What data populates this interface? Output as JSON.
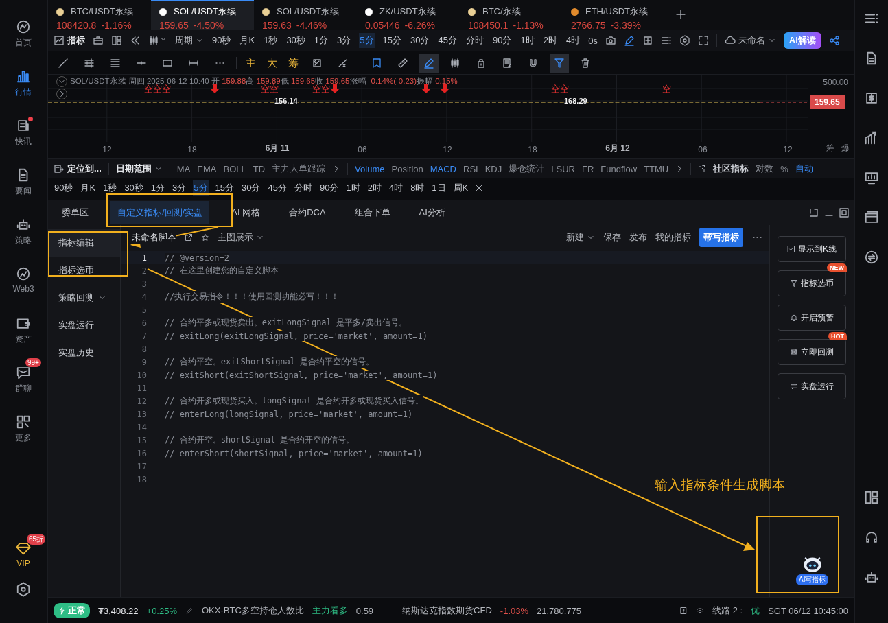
{
  "nav": {
    "items": [
      {
        "label": "首页",
        "selected": false,
        "dot": false
      },
      {
        "label": "行情",
        "selected": true,
        "dot": false
      },
      {
        "label": "快讯",
        "selected": false,
        "dot": true
      },
      {
        "label": "要闻",
        "selected": false,
        "dot": false
      },
      {
        "label": "策略",
        "selected": false,
        "dot": false
      },
      {
        "label": "Web3",
        "selected": false,
        "dot": false
      },
      {
        "label": "资产",
        "selected": false,
        "dot": false
      },
      {
        "label": "群聊",
        "selected": false,
        "dot": false,
        "badge": "99+"
      },
      {
        "label": "更多",
        "selected": false,
        "dot": false
      }
    ],
    "vip": {
      "label": "VIP",
      "badge": "65折"
    }
  },
  "market_tabs": [
    {
      "symbol": "BTC/USDT永续",
      "price": "108420.8",
      "change": "-1.16%",
      "selected": false,
      "color": "#e9cf95"
    },
    {
      "symbol": "SOL/USDT永续",
      "price": "159.65",
      "change": "-4.50%",
      "selected": true,
      "color": "#ffffff"
    },
    {
      "symbol": "SOL/USDT永续",
      "price": "159.63",
      "change": "-4.46%",
      "selected": false,
      "color": "#e9cf95"
    },
    {
      "symbol": "ZK/USDT永续",
      "price": "0.05446",
      "change": "-6.26%",
      "selected": false,
      "color": "#ffffff"
    },
    {
      "symbol": "BTC/永续",
      "price": "108450.1",
      "change": "-1.13%",
      "selected": false,
      "color": "#e9cf95"
    },
    {
      "symbol": "ETH/USDT永续",
      "price": "2766.75",
      "change": "-3.39%",
      "selected": false,
      "color": "#e08a2c"
    }
  ],
  "toolbar": {
    "indicator_button": "指标",
    "period_label": "周期",
    "periods": [
      {
        "label": "90秒",
        "selected": false
      },
      {
        "label": "月K",
        "selected": false
      },
      {
        "label": "1秒",
        "selected": false
      },
      {
        "label": "30秒",
        "selected": false
      },
      {
        "label": "1分",
        "selected": false
      },
      {
        "label": "3分",
        "selected": false
      },
      {
        "label": "5分",
        "selected": true
      },
      {
        "label": "15分",
        "selected": false
      },
      {
        "label": "30分",
        "selected": false
      },
      {
        "label": "45分",
        "selected": false
      },
      {
        "label": "分时",
        "selected": false
      },
      {
        "label": "90分",
        "selected": false
      },
      {
        "label": "1时",
        "selected": false
      },
      {
        "label": "2时",
        "selected": false
      },
      {
        "label": "4时",
        "selected": false
      }
    ],
    "countdown": "0s",
    "layout_name": "未命名",
    "ai_button": "AI解读"
  },
  "draw_tools": {
    "shape_tools": [
      {
        "selected": false
      },
      {
        "selected": false
      },
      {
        "selected": false
      },
      {
        "selected": false
      },
      {
        "selected": false
      },
      {
        "selected": false
      },
      {
        "selected": false
      }
    ],
    "text_tools": [
      "主",
      "大",
      "筹"
    ],
    "mode_tools": [
      {
        "selected": false
      },
      {
        "selected": false
      },
      {
        "selected": false
      },
      {
        "selected": false
      },
      {
        "selected": true
      },
      {
        "selected": false
      },
      {
        "selected": false
      },
      {
        "selected": false
      },
      {
        "selected": false
      },
      {
        "selected": true
      },
      {
        "selected": false
      }
    ]
  },
  "chart": {
    "legend": {
      "symbol": "SOL/USDT永续",
      "weekday": "周四",
      "datetime": "2025-06-12 10:40",
      "fields": [
        {
          "label": "开",
          "value": "159.88"
        },
        {
          "label": "高",
          "value": "159.89"
        },
        {
          "label": "低",
          "value": "159.65"
        },
        {
          "label": "收",
          "value": "159.65"
        },
        {
          "label": "涨幅",
          "value": "-0.14%(-0.23)"
        },
        {
          "label": "振幅",
          "value": "0.15%"
        }
      ]
    },
    "signals": [
      "空空空",
      "空空",
      "空空",
      "空空",
      "空"
    ],
    "price_labels": [
      "156.14",
      "168.29"
    ],
    "y_tick": "500.00",
    "last_price": "159.65",
    "x_labels": [
      {
        "label": "12",
        "major": false
      },
      {
        "label": "18",
        "major": false
      },
      {
        "label": "6月 11",
        "major": true
      },
      {
        "label": "06",
        "major": false
      },
      {
        "label": "12",
        "major": false
      },
      {
        "label": "18",
        "major": false
      },
      {
        "label": "6月 12",
        "major": true
      },
      {
        "label": "06",
        "major": false
      },
      {
        "label": "12",
        "major": false
      }
    ],
    "side_labels": [
      "筹",
      "爆"
    ]
  },
  "indicator_bar": {
    "locate": "定位到...",
    "date_range": "日期范围",
    "main_indicators": [
      "MA",
      "EMA",
      "BOLL",
      "TD",
      "主力大单跟踪"
    ],
    "sub_indicators": [
      {
        "label": "Volume",
        "selected": true
      },
      {
        "label": "Position",
        "selected": false
      },
      {
        "label": "MACD",
        "selected": true
      },
      {
        "label": "RSI",
        "selected": false
      },
      {
        "label": "KDJ",
        "selected": false
      },
      {
        "label": "爆仓统计",
        "selected": false
      },
      {
        "label": "LSUR",
        "selected": false
      },
      {
        "label": "FR",
        "selected": false
      },
      {
        "label": "Fundflow",
        "selected": false
      },
      {
        "label": "TTMU",
        "selected": false
      }
    ],
    "community": "社区指标",
    "options": [
      {
        "label": "对数",
        "selected": false
      },
      {
        "label": "%",
        "selected": false
      },
      {
        "label": "自动",
        "selected": true
      }
    ]
  },
  "period_row": [
    {
      "label": "90秒",
      "selected": false
    },
    {
      "label": "月K",
      "selected": false
    },
    {
      "label": "1秒",
      "selected": false
    },
    {
      "label": "30秒",
      "selected": false
    },
    {
      "label": "1分",
      "selected": false
    },
    {
      "label": "3分",
      "selected": false
    },
    {
      "label": "5分",
      "selected": true
    },
    {
      "label": "15分",
      "selected": false
    },
    {
      "label": "30分",
      "selected": false
    },
    {
      "label": "45分",
      "selected": false
    },
    {
      "label": "分时",
      "selected": false
    },
    {
      "label": "90分",
      "selected": false
    },
    {
      "label": "1时",
      "selected": false
    },
    {
      "label": "2时",
      "selected": false
    },
    {
      "label": "4时",
      "selected": false
    },
    {
      "label": "8时",
      "selected": false
    },
    {
      "label": "1日",
      "selected": false
    },
    {
      "label": "周K",
      "selected": false
    }
  ],
  "panel_tabs": [
    {
      "label": "委单区",
      "selected": false
    },
    {
      "label": "自定义指标/回测/实盘",
      "selected": true
    },
    {
      "label": "AI 网格",
      "selected": false
    },
    {
      "label": "合约DCA",
      "selected": false
    },
    {
      "label": "组合下单",
      "selected": false
    },
    {
      "label": "AI分析",
      "selected": false
    }
  ],
  "script_menu": [
    {
      "label": "指标编辑",
      "selected": true,
      "kind": "item"
    },
    {
      "label": "指标选币",
      "selected": false,
      "kind": "item"
    },
    {
      "label": "策略回测",
      "selected": false,
      "kind": "group"
    },
    {
      "label": "实盘运行",
      "selected": false,
      "kind": "item"
    },
    {
      "label": "实盘历史",
      "selected": false,
      "kind": "item"
    }
  ],
  "editor": {
    "script_name": "未命名脚本",
    "display_mode": "主图展示",
    "actions": [
      {
        "label": "新建",
        "dropdown": true
      },
      {
        "label": "保存",
        "dropdown": false
      },
      {
        "label": "发布",
        "dropdown": false
      },
      {
        "label": "我的指标",
        "dropdown": false
      }
    ],
    "primary_action": "帮写指标",
    "lines": [
      {
        "number": "1",
        "text": "// @version=2"
      },
      {
        "number": "2",
        "text": "// 在这里创建您的自定义脚本"
      },
      {
        "number": "3"
      },
      {
        "number": "4",
        "text": "//执行交易指令！！！使用回测功能必写！！！"
      },
      {
        "number": "5"
      },
      {
        "number": "6",
        "text": "// 合约平多或现货卖出。exitLongSignal 是平多/卖出信号。"
      },
      {
        "number": "7",
        "text": "// exitLong(exitLongSignal, price='market', amount=1)"
      },
      {
        "number": "8"
      },
      {
        "number": "9",
        "text": "// 合约平空。exitShortSignal 是合约平空的信号。"
      },
      {
        "number": "10",
        "text": "// exitShort(exitShortSignal, price='market', amount=1)"
      },
      {
        "number": "11"
      },
      {
        "number": "12",
        "text": "// 合约开多或现货买入。longSignal 是合约开多或现货买入信号。"
      },
      {
        "number": "13",
        "text": "// enterLong(longSignal, price='market', amount=1)"
      },
      {
        "number": "14"
      },
      {
        "number": "15",
        "text": "// 合约开空。shortSignal 是合约开空的信号。"
      },
      {
        "number": "16",
        "text": "// enterShort(shortSignal, price='market', amount=1)"
      },
      {
        "number": "17"
      },
      {
        "number": "18"
      }
    ]
  },
  "side_buttons": [
    {
      "label": "显示到K线"
    },
    {
      "label": "指标选币",
      "tag": "NEW"
    },
    {
      "label": "开启预警"
    },
    {
      "label": "立即回测",
      "tag": "HOT"
    },
    {
      "label": "实盘运行"
    }
  ],
  "annotation": {
    "caption": "输入指标条件生成脚本",
    "bot_label": "AI写指标"
  },
  "status_bar": {
    "status": "正常",
    "price": "₮3,408.22",
    "change": "+0.25%",
    "ratio_label": "OKX-BTC多空持仓人数比",
    "ratio_sentiment": "主力看多",
    "ratio_value": "0.59",
    "index_label": "纳斯达克指数期货CFD",
    "index_change": "-1.03%",
    "index_value": "21,780.775",
    "line_label": "线路 2 :",
    "line_quality": "优",
    "time": "SGT 06/12 10:45:00"
  }
}
